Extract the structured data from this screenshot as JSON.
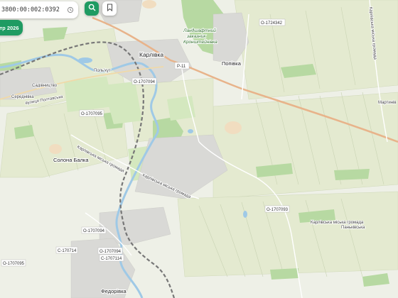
{
  "search": {
    "value": "3800:00:002:0392",
    "history_icon": "history-icon",
    "search_icon": "search-icon",
    "bookmark_icon": "bookmark-icon"
  },
  "date_badge": "тр 2026",
  "colors": {
    "accent": "#1f9b62",
    "land": "#eef0e7",
    "field": "#e8edd6",
    "forest": "#b7d9a2",
    "water": "#9fc9e6",
    "urban": "#d6d6d6",
    "road_main": "#e8b38a",
    "railway": "#777777"
  },
  "places": {
    "karlivka": "Карлівка",
    "popivka": "Попівка",
    "solona_balka": "Солона Балка",
    "fedorivka": "Федорівка",
    "landscape_park": [
      "Ландшафтний",
      "заказник",
      "Кронштейнівка"
    ],
    "pankivska": "Паньківська",
    "martynivka": "Мартинів",
    "poloi_kut": "Поль'кут",
    "sadivnyk": "Садівництво",
    "serednivka": "Середнівка"
  },
  "road_ids": {
    "r11": "Р-11",
    "o1724342": "О-1724342",
    "o1707094_top": "О-1707094",
    "o1707095_left": "О-1707095",
    "o1707093": "О-1707093",
    "o1707094_mid": "О-1707094",
    "c170714": "С-170714",
    "o1707094_low": "О-1707094",
    "c1707114": "С-1707114",
    "o1707095_low": "О-1707095"
  },
  "street_labels": {
    "poltavska": "вулиця Полтавська",
    "karlivska_hromada_1": "Карлівська міська громада",
    "karlivska_hromada_2": "Карлівська міська громада",
    "karlivska_hromada_3": "Карлівська міська громада",
    "karlivska_hromada_right": "Карлівська міська громада"
  }
}
